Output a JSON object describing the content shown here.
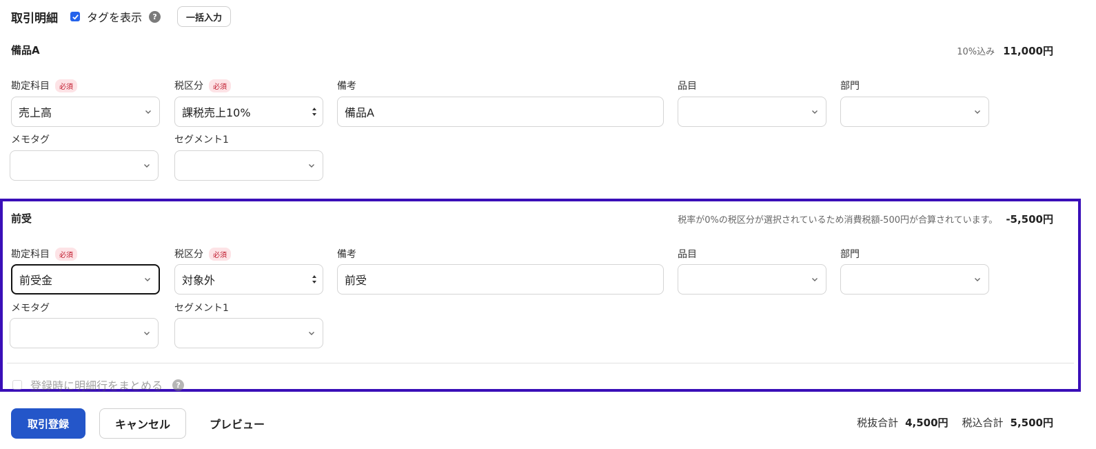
{
  "header": {
    "title": "取引明細",
    "show_tags_label": "タグを表示",
    "show_tags_checked": true,
    "help_glyph": "?",
    "bulk_input_label": "一括入力"
  },
  "sections": [
    {
      "title": "備品A",
      "amount_note": "10%込み",
      "amount": "11,000円",
      "labels": {
        "account": "勘定科目",
        "tax": "税区分",
        "memo": "備考",
        "item": "品目",
        "dept": "部門",
        "memo_tag": "メモタグ",
        "segment": "セグメント1",
        "required": "必須"
      },
      "values": {
        "account": "売上高",
        "tax": "課税売上10%",
        "memo": "備品A",
        "item": "",
        "dept": "",
        "memo_tag": "",
        "segment": ""
      }
    },
    {
      "title": "前受",
      "amount_note": "税率が0%の税区分が選択されているため消費税額-500円が合算されています。",
      "amount": "-5,500円",
      "labels": {
        "account": "勘定科目",
        "tax": "税区分",
        "memo": "備考",
        "item": "品目",
        "dept": "部門",
        "memo_tag": "メモタグ",
        "segment": "セグメント1",
        "required": "必須"
      },
      "values": {
        "account": "前受金",
        "tax": "対象外",
        "memo": "前受",
        "item": "",
        "dept": "",
        "memo_tag": "",
        "segment": ""
      },
      "merge_label": "登録時に明細行をまとめる",
      "merge_checked": false
    }
  ],
  "footer": {
    "register_label": "取引登録",
    "cancel_label": "キャンセル",
    "preview_label": "プレビュー",
    "subtotal_label": "税抜合計",
    "subtotal_value": "4,500円",
    "total_label": "税込合計",
    "total_value": "5,500円"
  },
  "colors": {
    "primary": "#2456c9",
    "checkbox": "#2563eb",
    "highlight_border": "#3a0fb8",
    "required_text": "#c0192c",
    "required_bg": "#fde3e6"
  },
  "icons": [
    "check-icon",
    "help-icon",
    "chevron-down-icon",
    "updown-arrows-icon"
  ]
}
